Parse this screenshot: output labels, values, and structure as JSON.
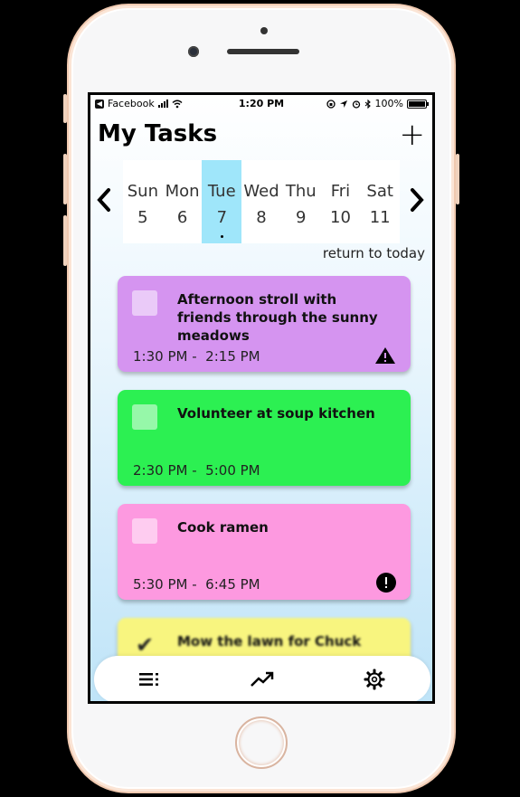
{
  "statusbar": {
    "back_app": "Facebook",
    "time": "1:20 PM",
    "battery": "100%"
  },
  "header": {
    "title": "My Tasks",
    "add_label": "+"
  },
  "week": {
    "prev_label": "‹",
    "next_label": "›",
    "days": [
      {
        "name": "Sun",
        "num": "5"
      },
      {
        "name": "Mon",
        "num": "6"
      },
      {
        "name": "Tue",
        "num": "7"
      },
      {
        "name": "Wed",
        "num": "8"
      },
      {
        "name": "Thu",
        "num": "9"
      },
      {
        "name": "Fri",
        "num": "10"
      },
      {
        "name": "Sat",
        "num": "11"
      }
    ],
    "return_label": "return to today"
  },
  "tasks": [
    {
      "title": "Afternoon stroll with friends through the sunny meadows",
      "start": "1:30 PM",
      "end": "2:15 PM",
      "color": "#d594f0",
      "flag": "warning-icon",
      "done": false
    },
    {
      "title": "Volunteer at soup kitchen",
      "start": "2:30 PM",
      "end": "5:00 PM",
      "color": "#2cf052",
      "flag": "",
      "done": false
    },
    {
      "title": "Cook ramen",
      "start": "5:30 PM",
      "end": "6:45 PM",
      "color": "#fd99e0",
      "flag": "exclamation-icon",
      "done": false
    },
    {
      "title": "Mow the lawn for Chuck",
      "color": "#f8f57f",
      "done": true
    }
  ],
  "tabbar": {
    "icons": [
      "list-icon",
      "trending-up-icon",
      "gear-icon"
    ]
  },
  "colors": {
    "active_day": "#9fe6fa"
  }
}
